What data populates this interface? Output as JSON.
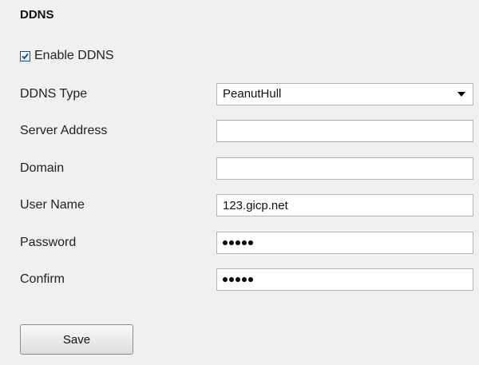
{
  "section_title": "DDNS",
  "enable": {
    "label": "Enable DDNS",
    "checked": true
  },
  "fields": {
    "ddns_type": {
      "label": "DDNS Type",
      "value": "PeanutHull"
    },
    "server_address": {
      "label": "Server Address",
      "value": ""
    },
    "domain": {
      "label": "Domain",
      "value": ""
    },
    "user_name": {
      "label": "User Name",
      "value": "123.gicp.net"
    },
    "password": {
      "label": "Password",
      "masked_length": 5
    },
    "confirm": {
      "label": "Confirm",
      "masked_length": 5
    }
  },
  "save_label": "Save",
  "colors": {
    "background": "#f0f0f0",
    "field_border": "#b4b4b4",
    "checkbox_border": "#1c5180"
  },
  "icons": {
    "checkbox": "checkmark-icon",
    "dropdown": "chevron-down-icon"
  }
}
